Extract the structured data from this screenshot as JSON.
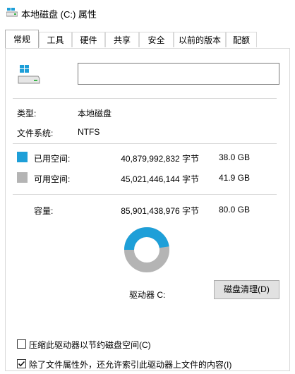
{
  "window": {
    "title": "本地磁盘 (C:) 属性"
  },
  "tabs": [
    "常规",
    "工具",
    "硬件",
    "共享",
    "安全",
    "以前的版本",
    "配额"
  ],
  "general": {
    "volume_name": "",
    "type_label": "类型:",
    "type_value": "本地磁盘",
    "fs_label": "文件系统:",
    "fs_value": "NTFS",
    "used": {
      "label": "已用空间:",
      "bytes": "40,879,992,832 字节",
      "size": "38.0 GB",
      "color": "#1e9fd8"
    },
    "free": {
      "label": "可用空间:",
      "bytes": "45,021,446,144 字节",
      "size": "41.9 GB",
      "color": "#b4b4b4"
    },
    "capacity": {
      "label": "容量:",
      "bytes": "85,901,438,976 字节",
      "size": "80.0 GB"
    },
    "used_fraction": 0.476,
    "drive_label": "驱动器 C:",
    "cleanup_button": "磁盘清理(D)",
    "compress_checkbox": {
      "label": "压缩此驱动器以节约磁盘空间(C)",
      "checked": false
    },
    "index_checkbox": {
      "label": "除了文件属性外，还允许索引此驱动器上文件的内容(I)",
      "checked": true
    }
  }
}
